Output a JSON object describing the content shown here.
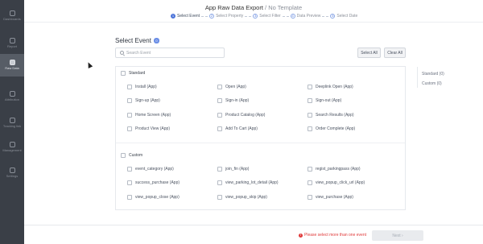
{
  "sidebar": {
    "items": [
      {
        "label": "Dashboards",
        "name": "sidebar-item-dashboards",
        "icon": "dashboard-icon"
      },
      {
        "label": "Report",
        "name": "sidebar-item-report",
        "icon": "report-icon"
      },
      {
        "label": "Raw Data",
        "name": "sidebar-item-raw-data",
        "icon": "raw-data-icon",
        "active": true
      },
      {
        "label": "Attribution",
        "name": "sidebar-item-attribution",
        "icon": "attribution-icon"
      },
      {
        "label": "Tracking link",
        "name": "sidebar-item-tracking-link",
        "icon": "link-icon"
      },
      {
        "label": "Management",
        "name": "sidebar-item-management",
        "icon": "management-icon"
      },
      {
        "label": "Settings",
        "name": "sidebar-item-settings",
        "icon": "gear-icon"
      }
    ]
  },
  "modal": {
    "title": "App Raw Data Export",
    "title_sep": " / ",
    "subtitle": "No Template"
  },
  "steps": [
    {
      "num": "1",
      "label": "Select Event",
      "active": true
    },
    {
      "num": "2",
      "label": "Select Property"
    },
    {
      "num": "3",
      "label": "Select Filter"
    },
    {
      "num": "4",
      "label": "Data Preview"
    },
    {
      "num": "5",
      "label": "Select Date"
    }
  ],
  "content": {
    "section_title": "Select Event",
    "selected_count": "0",
    "search_placeholder": "Search Event",
    "select_all_label": "Select All",
    "clear_all_label": "Clear All"
  },
  "groups": [
    {
      "name": "Standard",
      "events": [
        "Install (App)",
        "Open (App)",
        "Deeplink Open (App)",
        "Sign-up (App)",
        "Sign-in (App)",
        "Sign-out (App)",
        "Home Screen (App)",
        "Product Catalog (App)",
        "Search Results (App)",
        "Product View (App)",
        "Add To Cart (App)",
        "Order Complete (App)"
      ]
    },
    {
      "name": "Custom",
      "events": [
        "event_category (App)",
        "join_fin (App)",
        "regist_parkingpass (App)",
        "success_purchase (App)",
        "view_parking_lot_detail (App)",
        "view_popup_click_url (App)",
        "view_popup_close (App)",
        "view_popup_skip (App)",
        "view_purchase (App)"
      ]
    }
  ],
  "right_summary": [
    {
      "label": "Standard (0)"
    },
    {
      "label": "Custom (0)"
    }
  ],
  "footer": {
    "warning": "Please select more than one event",
    "next_label": "Next"
  },
  "colors": {
    "accent": "#4c74d9",
    "warning": "#e03a3a",
    "sidebar_bg": "#3a3f47"
  }
}
